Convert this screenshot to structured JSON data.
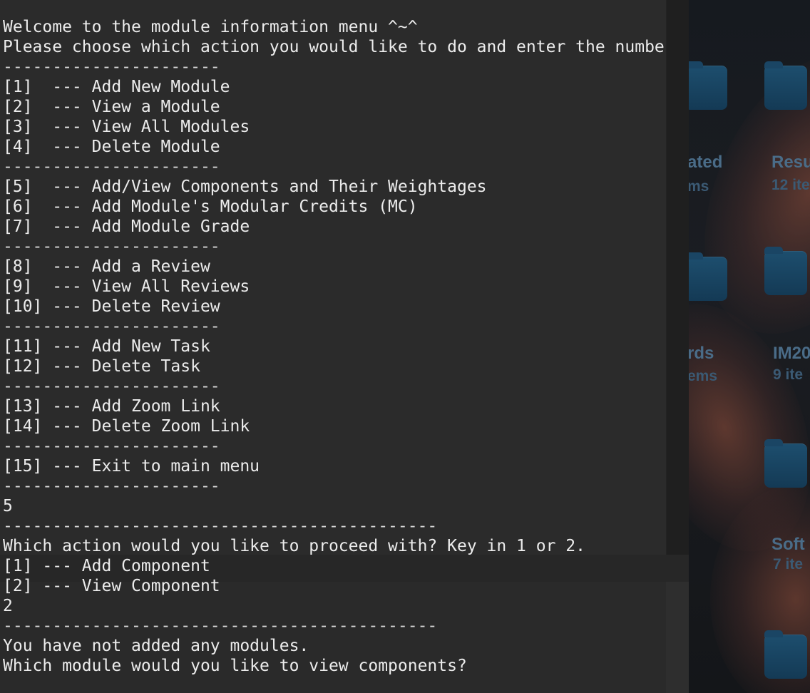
{
  "terminal": {
    "welcome": "Welcome to the module information menu ^~^",
    "prompt": "Please choose which action you would like to do and enter the number:",
    "separator_short": "----------------------",
    "separator_long": "--------------------------------------------",
    "menu": [
      "[1]  --- Add New Module",
      "[2]  --- View a Module",
      "[3]  --- View All Modules",
      "[4]  --- Delete Module",
      "[5]  --- Add/View Components and Their Weightages",
      "[6]  --- Add Module's Modular Credits (MC)",
      "[7]  --- Add Module Grade",
      "[8]  --- Add a Review",
      "[9]  --- View All Reviews",
      "[10] --- Delete Review",
      "[11] --- Add New Task",
      "[12] --- Delete Task",
      "[13] --- Add Zoom Link",
      "[14] --- Delete Zoom Link",
      "[15] --- Exit to main menu"
    ],
    "input_1": "5",
    "question": "Which action would you like to proceed with? Key in 1 or 2.",
    "sub_options": [
      "[1] --- Add Component",
      "[2] --- View Component"
    ],
    "input_2": "2",
    "message": "You have not added any modules.",
    "final_prompt": "Which module would you like to view components?"
  },
  "desktop": {
    "items": [
      {
        "name_fragment": "ated",
        "count_fragment": "ms",
        "icon": "folder-icon"
      },
      {
        "name_fragment": "Resu",
        "count_fragment": "12 ite",
        "icon": "folder-icon"
      },
      {
        "name_fragment": "rds",
        "count_fragment": "ems",
        "icon": "folder-icon"
      },
      {
        "name_fragment": "IM20",
        "count_fragment": "9 ite",
        "icon": "folder-icon"
      },
      {
        "name_fragment": "Soft",
        "count_fragment": "7 ite",
        "icon": "folder-icon"
      }
    ]
  }
}
